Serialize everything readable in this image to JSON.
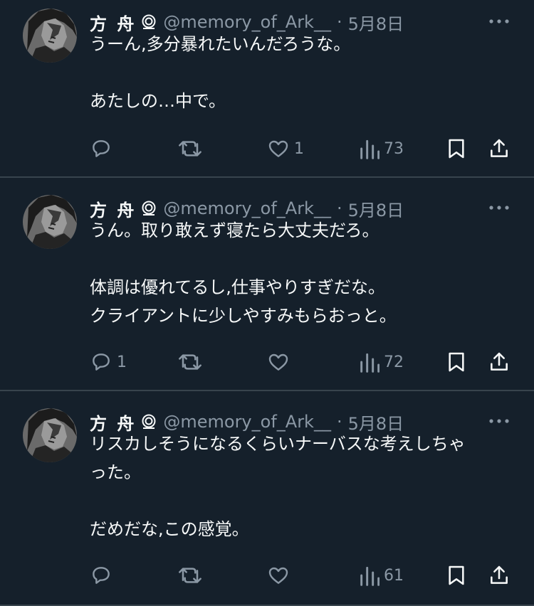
{
  "colors": {
    "background": "#15202b",
    "primary_text": "#f7f9f9",
    "secondary_text": "#8b98a5",
    "divider": "#38444d"
  },
  "tweets": [
    {
      "name": "方 舟",
      "handle": "@memory_of_Ark__",
      "separator": "·",
      "date": "5月8日",
      "lines": [
        "うーん,多分暴れたいんだろうな。",
        "",
        "あたしの…中で。"
      ],
      "replies": "",
      "retweets": "",
      "likes": "1",
      "views": "73"
    },
    {
      "name": "方 舟",
      "handle": "@memory_of_Ark__",
      "separator": "·",
      "date": "5月8日",
      "lines": [
        "うん。取り敢えず寝たら大丈夫だろ。",
        "",
        "体調は優れてるし,仕事やりすぎだな。",
        "クライアントに少しやすみもらおっと。"
      ],
      "replies": "1",
      "retweets": "",
      "likes": "",
      "views": "72"
    },
    {
      "name": "方 舟",
      "handle": "@memory_of_Ark__",
      "separator": "·",
      "date": "5月8日",
      "lines": [
        "リスカしそうになるくらいナーバスな考えしちゃ",
        "った。",
        "",
        "だめだな,この感覚。"
      ],
      "replies": "",
      "retweets": "",
      "likes": "",
      "views": "61"
    }
  ]
}
